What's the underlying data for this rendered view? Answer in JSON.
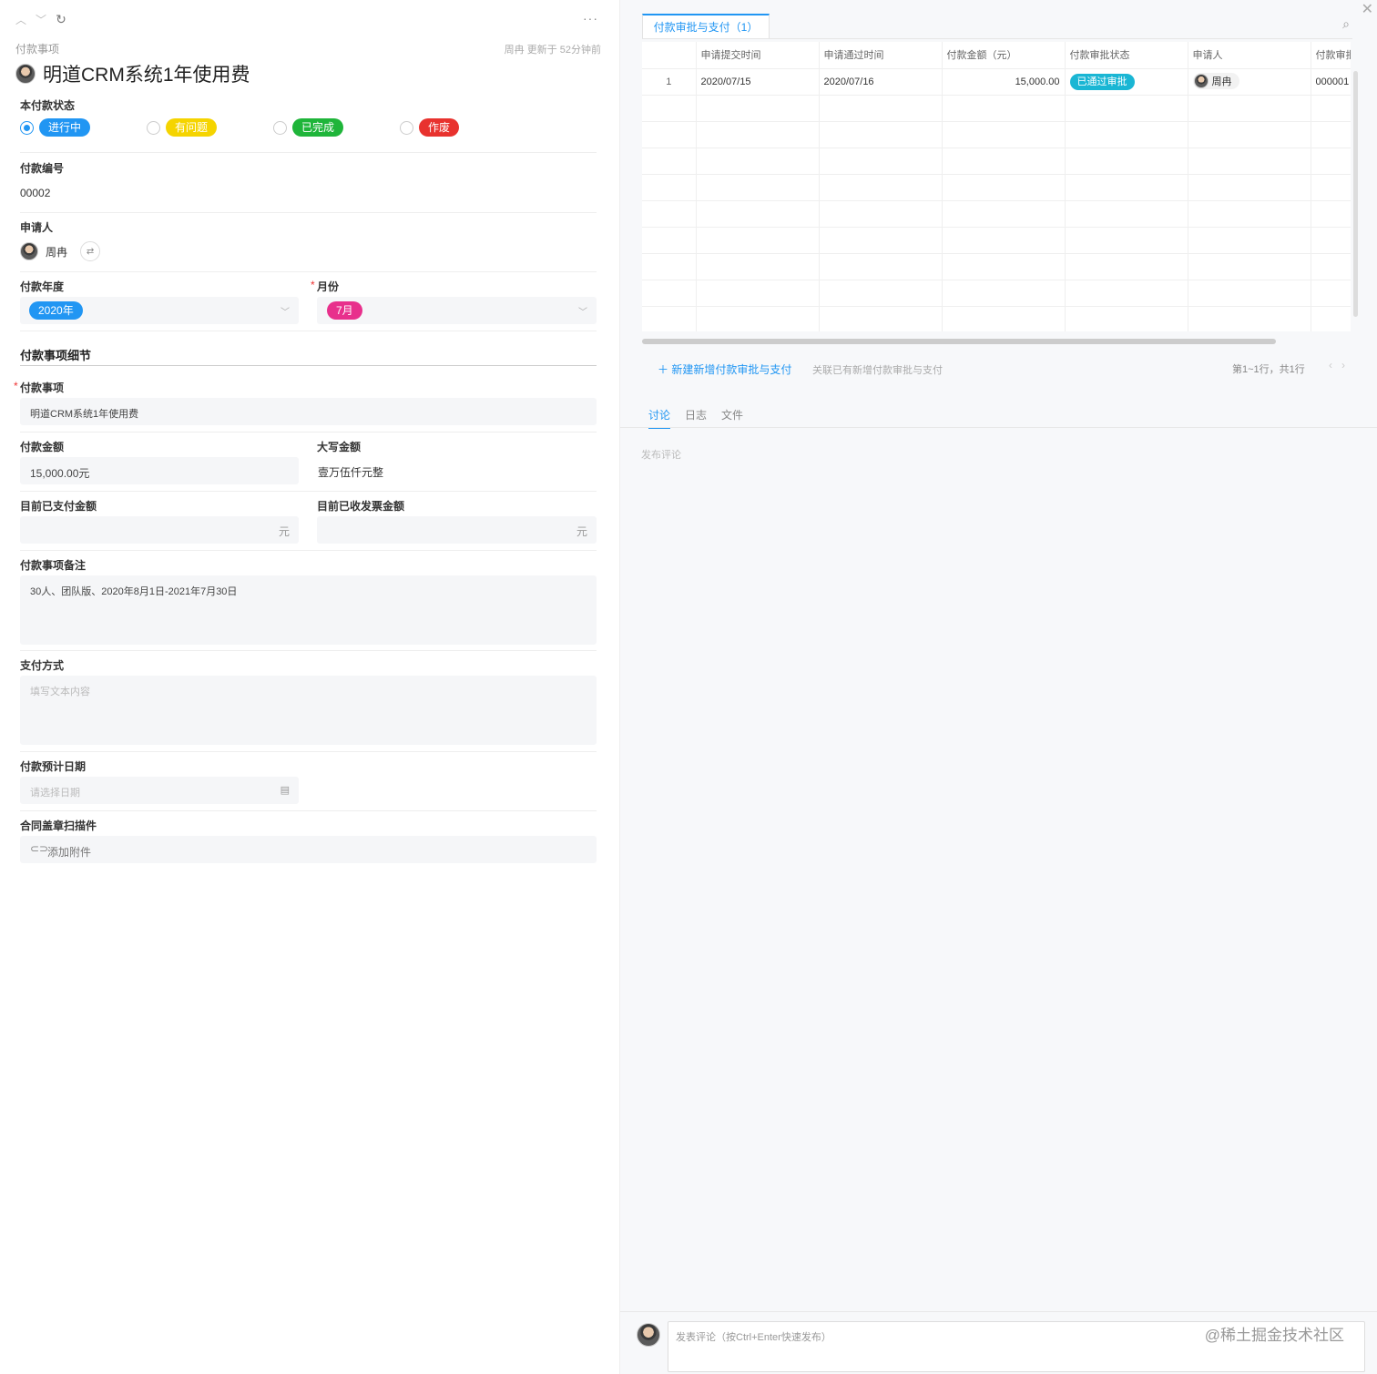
{
  "header": {
    "breadcrumb": "付款事项",
    "updated": "周冉 更新于 52分钟前",
    "title": "明道CRM系统1年使用费",
    "more": "···"
  },
  "status": {
    "label": "本付款状态",
    "options": [
      {
        "label": "进行中",
        "color": "#2196f3",
        "selected": true
      },
      {
        "label": "有问题",
        "color": "#f5d400",
        "selected": false
      },
      {
        "label": "已完成",
        "color": "#1fb53a",
        "selected": false
      },
      {
        "label": "作废",
        "color": "#e8322e",
        "selected": false
      }
    ]
  },
  "payment_no": {
    "label": "付款编号",
    "value": "00002"
  },
  "applicant": {
    "label": "申请人",
    "name": "周冉"
  },
  "year": {
    "label": "付款年度",
    "value": "2020年",
    "color": "#2196f3"
  },
  "month": {
    "label": "月份",
    "value": "7月",
    "color": "#e8308c"
  },
  "detail_section": "付款事项细节",
  "item": {
    "label": "付款事项",
    "value": "明道CRM系统1年使用费"
  },
  "amount": {
    "label": "付款金额",
    "value": "15,000.00元"
  },
  "amount_upper": {
    "label": "大写金额",
    "value": "壹万伍仟元整"
  },
  "paid": {
    "label": "目前已支付金额",
    "suffix": "元"
  },
  "invoiced": {
    "label": "目前已收发票金额",
    "suffix": "元"
  },
  "remark": {
    "label": "付款事项备注",
    "value": "30人、团队版、2020年8月1日-2021年7月30日"
  },
  "pay_method": {
    "label": "支付方式",
    "placeholder": "填写文本内容"
  },
  "due_date": {
    "label": "付款预计日期",
    "placeholder": "请选择日期"
  },
  "contract": {
    "label": "合同盖章扫描件",
    "button": "添加附件"
  },
  "right": {
    "tab": "付款审批与支付（1）",
    "columns": [
      "",
      "申请提交时间",
      "申请通过时间",
      "付款金额（元）",
      "付款审批状态",
      "申请人",
      "付款审批"
    ],
    "rows": [
      {
        "idx": "1",
        "submit": "2020/07/15",
        "pass": "2020/07/16",
        "amount": "15,000.00",
        "status": "已通过审批",
        "status_color": "#1ab6d4",
        "applicant": "周冉",
        "code": "000001"
      }
    ],
    "new_link": "新建新增付款审批与支付",
    "related_link": "关联已有新增付款审批与支付",
    "pager": "第1~1行，共1行",
    "sub_tabs": [
      "讨论",
      "日志",
      "文件"
    ],
    "publish_label": "发布评论",
    "comment_placeholder": "发表评论（按Ctrl+Enter快速发布）",
    "watermark": "@稀土掘金技术社区"
  }
}
